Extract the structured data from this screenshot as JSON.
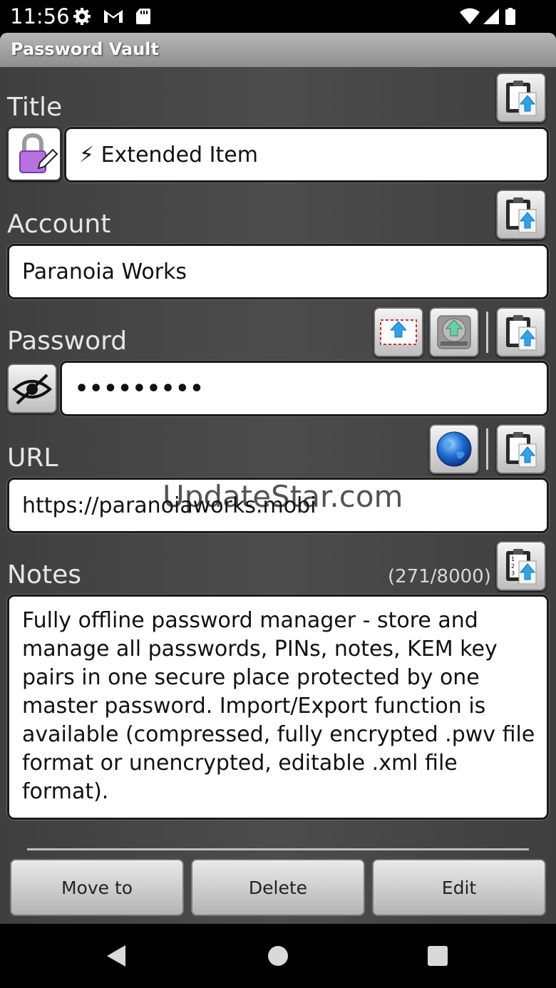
{
  "status_bar": {
    "time": "11:56",
    "left_icons": [
      "gear-icon",
      "gmail-icon",
      "sd-card-icon"
    ],
    "right_icons": [
      "wifi-icon",
      "signal-icon",
      "battery-icon"
    ]
  },
  "app": {
    "title": "Password Vault"
  },
  "title_section": {
    "label": "Title",
    "value": "⚡ Extended Item",
    "icon_button": "lock-edit-icon",
    "copy_button": "clipboard-copy-icon"
  },
  "account_section": {
    "label": "Account",
    "value": "Paranoia Works",
    "copy_button": "clipboard-copy-icon"
  },
  "password_section": {
    "label": "Password",
    "value": "•••••••••",
    "visibility_button": "eye-hidden-icon",
    "buttons": [
      "send-envelope-icon",
      "storage-upload-icon",
      "clipboard-copy-icon"
    ]
  },
  "url_section": {
    "label": "URL",
    "value": "https://paranoiaworks.mobi",
    "buttons": [
      "globe-icon",
      "clipboard-copy-icon"
    ]
  },
  "notes_section": {
    "label": "Notes",
    "counter": "(271/8000)",
    "value": "Fully offline password manager - store and manage all passwords, PINs, notes, KEM key pairs in one secure place protected by one master password. Import/Export function is available (compressed, fully encrypted .pwv file format or unencrypted, editable .xml file format).",
    "copy_button": "clipboard-numbered-copy-icon"
  },
  "actions": {
    "move_label": "Move to",
    "delete_label": "Delete",
    "edit_label": "Edit"
  },
  "watermark": "UpdateStar.com",
  "nav": [
    "back-icon",
    "home-icon",
    "recents-icon"
  ]
}
